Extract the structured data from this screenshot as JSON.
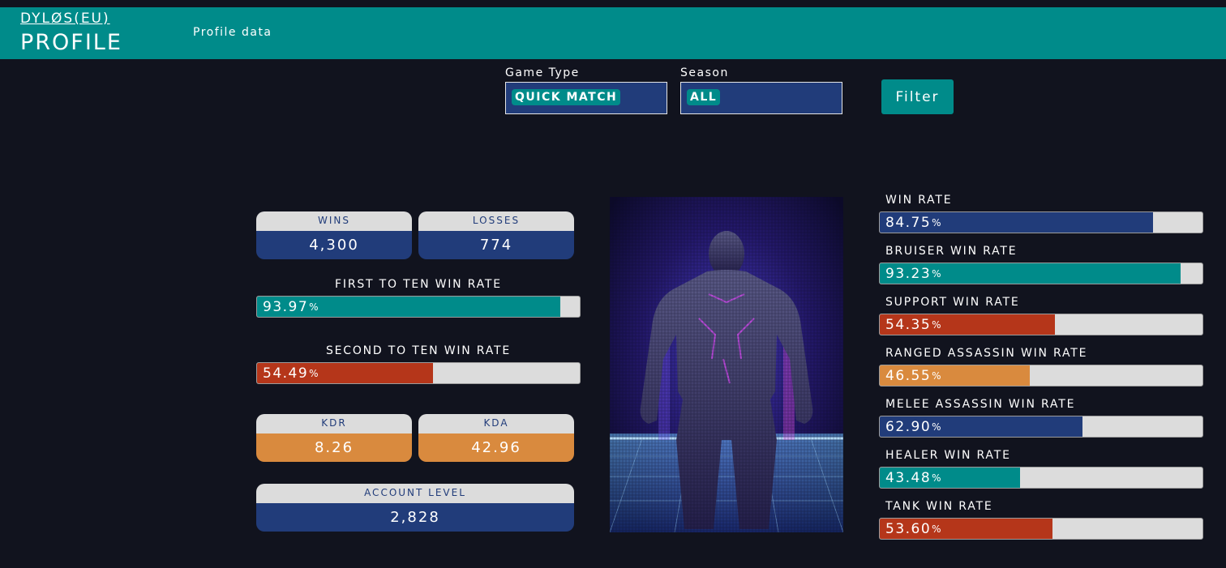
{
  "header": {
    "player_name": "DYLØS(EU)",
    "page_title": "PROFILE",
    "nav_link": "Profile data"
  },
  "filters": {
    "game_type": {
      "label": "Game Type",
      "value": "QUICK MATCH"
    },
    "season": {
      "label": "Season",
      "value": "ALL"
    },
    "button_label": "Filter"
  },
  "stats": {
    "wins": {
      "label": "WINS",
      "value": "4,300"
    },
    "losses": {
      "label": "LOSSES",
      "value": "774"
    },
    "kdr": {
      "label": "KDR",
      "value": "8.26"
    },
    "kda": {
      "label": "KDA",
      "value": "42.96"
    },
    "account_level": {
      "label": "ACCOUNT LEVEL",
      "value": "2,828"
    }
  },
  "left_rates": [
    {
      "title": "FIRST TO TEN WIN RATE",
      "value": "93.97",
      "percent": 93.97,
      "color": "#008b8a"
    },
    {
      "title": "SECOND TO TEN WIN RATE",
      "value": "54.49",
      "percent": 54.49,
      "color": "#b5361a"
    }
  ],
  "right_rates": [
    {
      "title": "WIN RATE",
      "value": "84.75",
      "percent": 84.75,
      "color": "#213c7a"
    },
    {
      "title": "BRUISER WIN RATE",
      "value": "93.23",
      "percent": 93.23,
      "color": "#008b8a"
    },
    {
      "title": "SUPPORT WIN RATE",
      "value": "54.35",
      "percent": 54.35,
      "color": "#b5361a"
    },
    {
      "title": "RANGED ASSASSIN WIN RATE",
      "value": "46.55",
      "percent": 46.55,
      "color": "#d98a3e"
    },
    {
      "title": "MELEE ASSASSIN WIN RATE",
      "value": "62.90",
      "percent": 62.9,
      "color": "#213c7a"
    },
    {
      "title": "HEALER WIN RATE",
      "value": "43.48",
      "percent": 43.48,
      "color": "#008b8a"
    },
    {
      "title": "TANK WIN RATE",
      "value": "53.60",
      "percent": 53.6,
      "color": "#b5361a"
    }
  ],
  "percent_sign": "%",
  "colors": {
    "header": "#008b8a",
    "background": "#11131e",
    "navy": "#213c7a",
    "teal": "#008b8a",
    "red": "#b5361a",
    "orange": "#d98a3e",
    "bar_empty": "#dcdcdc"
  },
  "hero_image": "hero-portrait"
}
